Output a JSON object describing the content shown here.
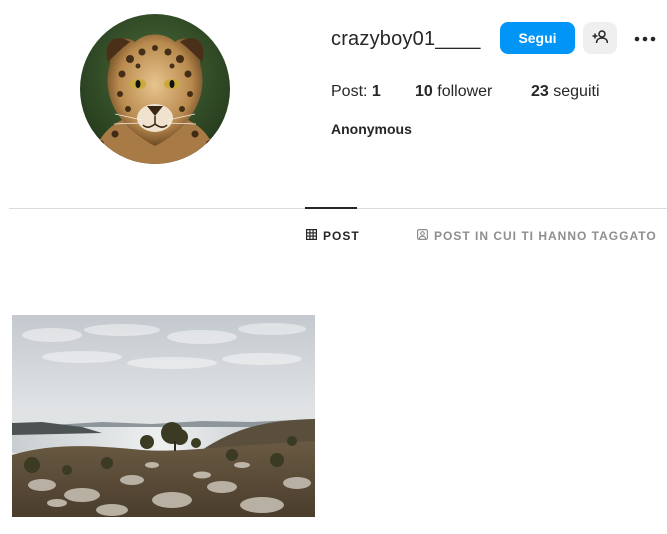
{
  "profile": {
    "username": "crazyboy01____",
    "full_name": "Anonymous",
    "avatar_icon": "jaguar-avatar",
    "follow_label": "Segui",
    "suggest_icon": "add-person-icon",
    "more_icon": "more-options-icon"
  },
  "stats": {
    "posts_label": "Post: ",
    "posts_count": "1",
    "followers_count": "10",
    "followers_label": " follower",
    "following_count": "23",
    "following_label": " seguiti"
  },
  "tabs": [
    {
      "label": "POST",
      "icon": "grid-icon",
      "active": true
    },
    {
      "label": "POST IN CUI TI HANNO TAGGATO",
      "icon": "tagged-icon",
      "active": false
    }
  ],
  "posts": [
    {
      "thumbnail": "landscape-photo"
    }
  ],
  "colors": {
    "accent": "#0095f6",
    "secondary_button": "#efefef",
    "divider": "#dbdbdb",
    "text_primary": "#262626",
    "text_secondary": "#8e8e8e"
  }
}
